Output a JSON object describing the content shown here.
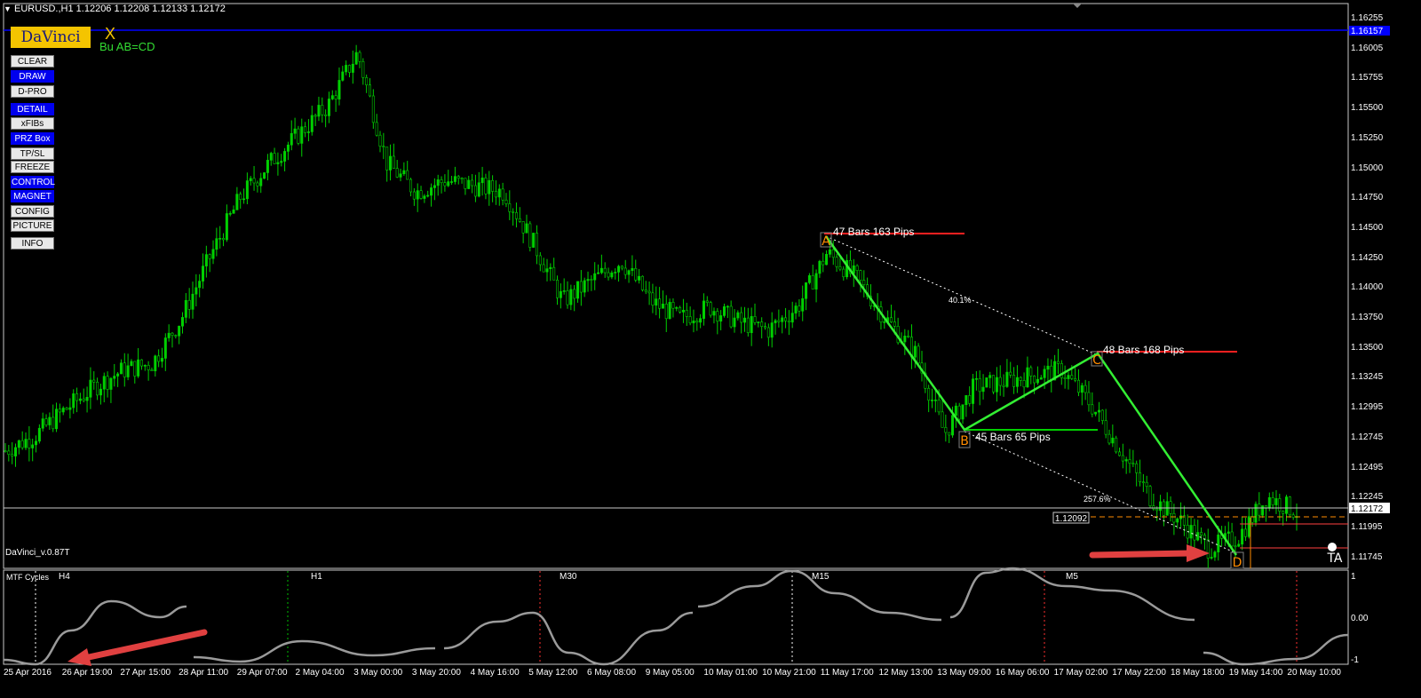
{
  "chart_header": "EURUSD.,H1  1.12206 1.12208 1.12133 1.12172",
  "logo_text": "DaVinci",
  "x_marker": "X",
  "pattern_name": "Bu AB=CD",
  "buttons": [
    {
      "label": "CLEAR",
      "style": "light"
    },
    {
      "label": "DRAW",
      "style": "blue"
    },
    {
      "label": "D-PRO",
      "style": "light"
    },
    {
      "label": "DETAIL",
      "style": "blue"
    },
    {
      "label": "xFIBs",
      "style": "light"
    },
    {
      "label": "PRZ Box",
      "style": "blue"
    },
    {
      "label": "TP/SL",
      "style": "light"
    },
    {
      "label": "FREEZE",
      "style": "light"
    },
    {
      "label": "CONTROL",
      "style": "blue"
    },
    {
      "label": "MAGNET",
      "style": "blue"
    },
    {
      "label": "CONFIG",
      "style": "light"
    },
    {
      "label": "PICTURE",
      "style": "light"
    },
    {
      "label": "INFO",
      "style": "light"
    }
  ],
  "version": "DaVinci_v.0.87T",
  "price_axis": [
    "1.16255",
    "1.16005",
    "1.15755",
    "1.15500",
    "1.15250",
    "1.15000",
    "1.14750",
    "1.14500",
    "1.14250",
    "1.14000",
    "1.13750",
    "1.13500",
    "1.13245",
    "1.12995",
    "1.12745",
    "1.12495",
    "1.12245",
    "1.11995",
    "1.11745"
  ],
  "blue_line_price_label": "1.16157",
  "current_price_label": "1.12172",
  "target_price_label": "1.12092",
  "pattern_points": {
    "A": "A",
    "B": "B",
    "C": "C",
    "D": "D"
  },
  "annotations": {
    "ab": "47 Bars  163 Pips",
    "bc": "45 Bars  65 Pips",
    "cd": "48 Bars  168 Pips",
    "ret1": "40.1%",
    "ret2": "257.6%"
  },
  "indicator": {
    "title": "MTF Cycles",
    "timeframes": [
      "H4",
      "H1",
      "M30",
      "M15",
      "M5"
    ],
    "scale": [
      "1",
      "0.00",
      "-1"
    ]
  },
  "time_axis": [
    "25 Apr 2016",
    "26 Apr 19:00",
    "27 Apr 15:00",
    "28 Apr 11:00",
    "29 Apr 07:00",
    "2 May 04:00",
    "3 May 00:00",
    "3 May 20:00",
    "4 May 16:00",
    "5 May 12:00",
    "6 May 08:00",
    "9 May 05:00",
    "10 May 01:00",
    "10 May 21:00",
    "11 May 17:00",
    "12 May 13:00",
    "13 May 09:00",
    "16 May 06:00",
    "17 May 02:00",
    "17 May 22:00",
    "18 May 18:00",
    "19 May 14:00",
    "20 May 10:00"
  ],
  "ta_label": "TA",
  "colors": {
    "candle": "#00d000",
    "zigzag": "#33ee33",
    "blue_line": "#0000ff",
    "resistance": "#ff2020",
    "cycle": "#9a9a9a",
    "arrow": "#e04040",
    "point_marker": "#ff8c00"
  },
  "chart_data": {
    "type": "candlestick",
    "symbol": "EURUSD.",
    "timeframe": "H1",
    "ylim": [
      1.1171,
      1.1637
    ],
    "x": [
      "25 Apr",
      "26 Apr",
      "27 Apr",
      "28 Apr",
      "29 Apr",
      "2 May",
      "3 May",
      "4 May",
      "5 May",
      "6 May",
      "9 May",
      "10 May",
      "11 May",
      "12 May",
      "13 May",
      "16 May",
      "17 May",
      "18 May",
      "19 May",
      "20 May"
    ],
    "close_path": [
      1.127,
      1.1283,
      1.1305,
      1.1325,
      1.134,
      1.1346,
      1.1385,
      1.144,
      1.149,
      1.152,
      1.1545,
      1.157,
      1.1616,
      1.152,
      1.1495,
      1.1505,
      1.15,
      1.1495,
      1.145,
      1.14,
      1.1418,
      1.1435,
      1.14,
      1.1385,
      1.1395,
      1.1382,
      1.1375,
      1.1395,
      1.1442,
      1.142,
      1.1385,
      1.1355,
      1.1285,
      1.1325,
      1.133,
      1.1336,
      1.134,
      1.131,
      1.127,
      1.123,
      1.121,
      1.1185,
      1.1195,
      1.123,
      1.1217
    ],
    "pattern": {
      "name": "Bu AB=CD",
      "A": 1.1445,
      "B": 1.1282,
      "C": 1.1347,
      "D": 1.1179,
      "ab_bars": 47,
      "ab_pips": 163,
      "bc_bars": 45,
      "bc_pips": 65,
      "cd_bars": 48,
      "cd_pips": 168,
      "retracements": [
        "40.1%",
        "257.6%"
      ]
    },
    "levels": {
      "top": 1.16157,
      "current": 1.12172,
      "target": 1.12092
    }
  }
}
